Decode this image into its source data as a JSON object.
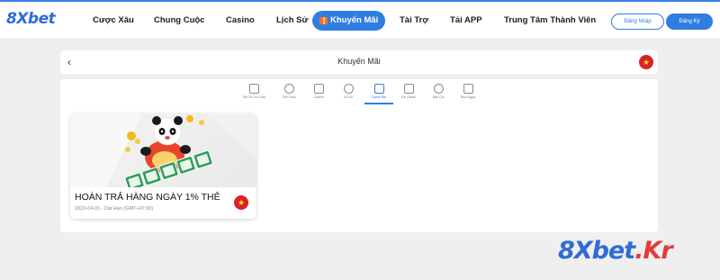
{
  "header": {
    "logo": "8Xbet",
    "nav": [
      {
        "label": "Cược Xâu"
      },
      {
        "label": "Chung Cuộc"
      },
      {
        "label": "Casino"
      },
      {
        "label": "Lịch Sử"
      },
      {
        "label": "Khuyến Mãi",
        "active": true
      },
      {
        "label": "Tài Trợ"
      },
      {
        "label": "Tải APP"
      },
      {
        "label": "Trung Tâm Thành Viên"
      }
    ],
    "login_label": "Đăng Nhập",
    "register_label": "Đăng Ký"
  },
  "page": {
    "back": "‹",
    "title": "Khuyến Mãi",
    "flag": "★"
  },
  "tabs": [
    {
      "label": "Tất Cả Trò Chơi",
      "icon": "grid-icon"
    },
    {
      "label": "Thể Thao",
      "icon": "ball-icon"
    },
    {
      "label": "Casino",
      "icon": "cards-icon"
    },
    {
      "label": "Xổ Số",
      "icon": "lottery-icon"
    },
    {
      "label": "Game Bài",
      "icon": "card-game-icon",
      "active": true
    },
    {
      "label": "Esl Game",
      "icon": "slot-icon"
    },
    {
      "label": "Bắn Cá",
      "icon": "fish-icon"
    },
    {
      "label": "Đua Ngựa",
      "icon": "horse-icon"
    }
  ],
  "promo": {
    "title": "HOÀN TRẢ HÀNG NGÀY 1% THẺ",
    "date": "2023-04-01 - Dài Hạn (GMT+07:00)",
    "flag": "★"
  },
  "watermark": {
    "main": "8Xbet",
    "suffix": ".Kr"
  },
  "colors": {
    "accent": "#2f7de1",
    "flag_red": "#d8222a",
    "flag_star": "#ffdd00"
  }
}
